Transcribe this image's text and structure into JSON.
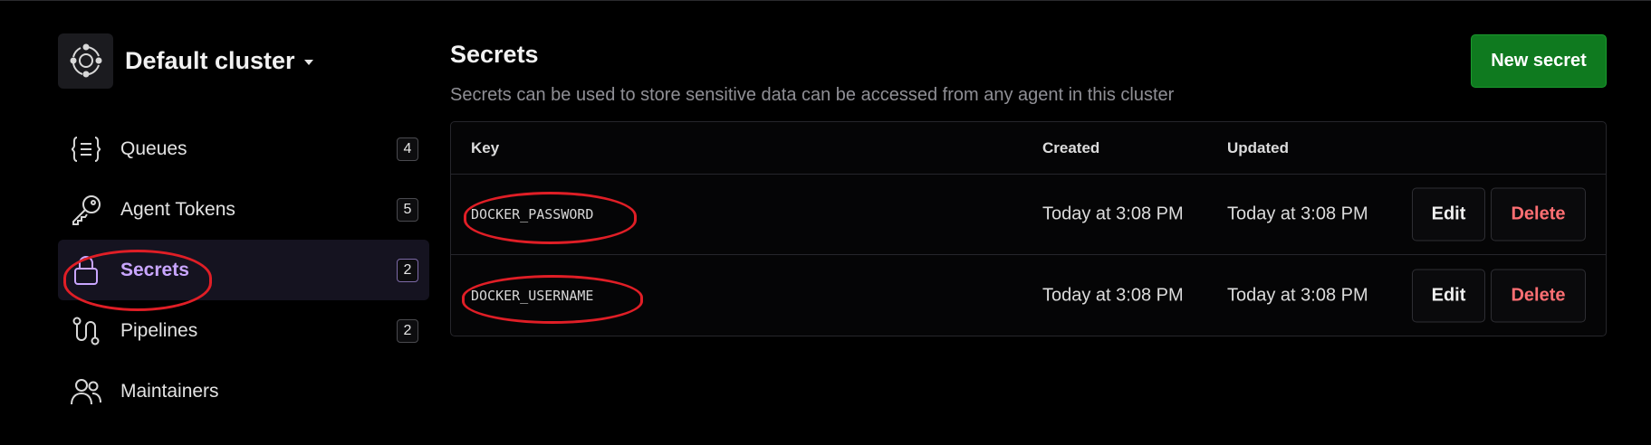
{
  "cluster": {
    "name": "Default cluster",
    "logo_icon": "cluster-icon"
  },
  "sidebar": {
    "items": [
      {
        "label": "Queues",
        "count": "4",
        "icon": "queue-list-icon",
        "active": false
      },
      {
        "label": "Agent Tokens",
        "count": "5",
        "icon": "key-icon",
        "active": false
      },
      {
        "label": "Secrets",
        "count": "2",
        "icon": "lock-icon",
        "active": true
      },
      {
        "label": "Pipelines",
        "count": "2",
        "icon": "pipeline-icon",
        "active": false
      },
      {
        "label": "Maintainers",
        "count": "",
        "icon": "users-icon",
        "active": false
      }
    ]
  },
  "main": {
    "title": "Secrets",
    "subtitle": "Secrets can be used to store sensitive data can be accessed from any agent in this cluster",
    "new_button": "New secret"
  },
  "table": {
    "columns": [
      "Key",
      "Created",
      "Updated"
    ],
    "rows": [
      {
        "key": "DOCKER_PASSWORD",
        "created": "Today at 3:08 PM",
        "updated": "Today at 3:08 PM",
        "edit": "Edit",
        "delete": "Delete"
      },
      {
        "key": "DOCKER_USERNAME",
        "created": "Today at 3:08 PM",
        "updated": "Today at 3:08 PM",
        "edit": "Edit",
        "delete": "Delete"
      }
    ]
  },
  "colors": {
    "accent": "#c9a6ff",
    "primary_button": "#0f7a1f",
    "danger": "#ff6f73",
    "annotation": "#e01e26"
  }
}
